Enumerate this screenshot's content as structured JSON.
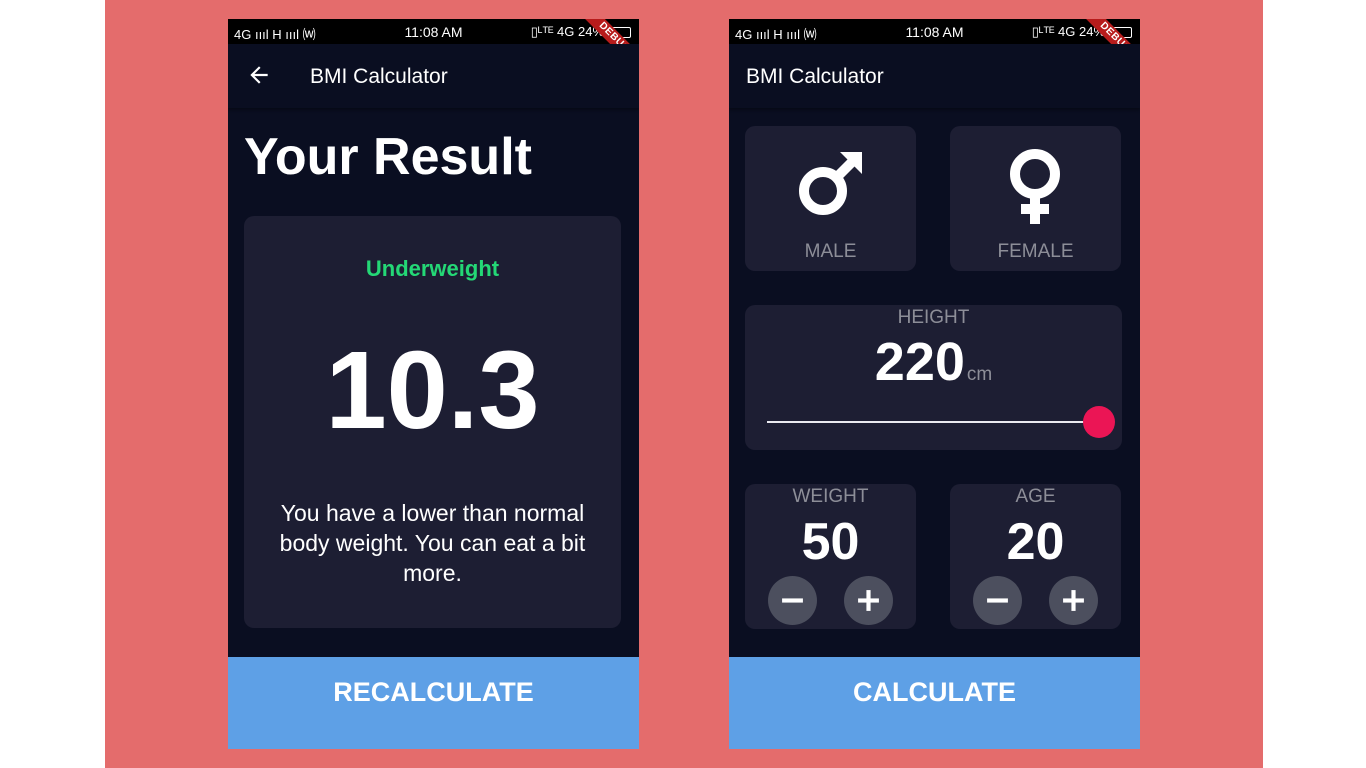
{
  "statusbar": {
    "left": "4G ıııl H ıııl ⒲",
    "time": "11:08 AM",
    "right": "▯ᴸᵀᴱ 4G 24%",
    "debug_label": "DEBUG"
  },
  "result_screen": {
    "app_title": "BMI Calculator",
    "heading": "Your Result",
    "status": "Underweight",
    "bmi": "10.3",
    "interpretation": "You have a lower than normal body weight. You can eat a bit more.",
    "button": "RECALCULATE"
  },
  "input_screen": {
    "app_title": "BMI Calculator",
    "male_label": "MALE",
    "female_label": "FEMALE",
    "height_label": "HEIGHT",
    "height_value": "220",
    "height_unit": "cm",
    "weight_label": "WEIGHT",
    "weight_value": "50",
    "age_label": "AGE",
    "age_value": "20",
    "button": "CALCULATE"
  },
  "colors": {
    "background": "#e46c6c",
    "screen": "#0a0e21",
    "card": "#1d1e33",
    "status_green": "#24d876",
    "slider_thumb": "#eb1555",
    "bottom_button": "#5ea0e6"
  }
}
